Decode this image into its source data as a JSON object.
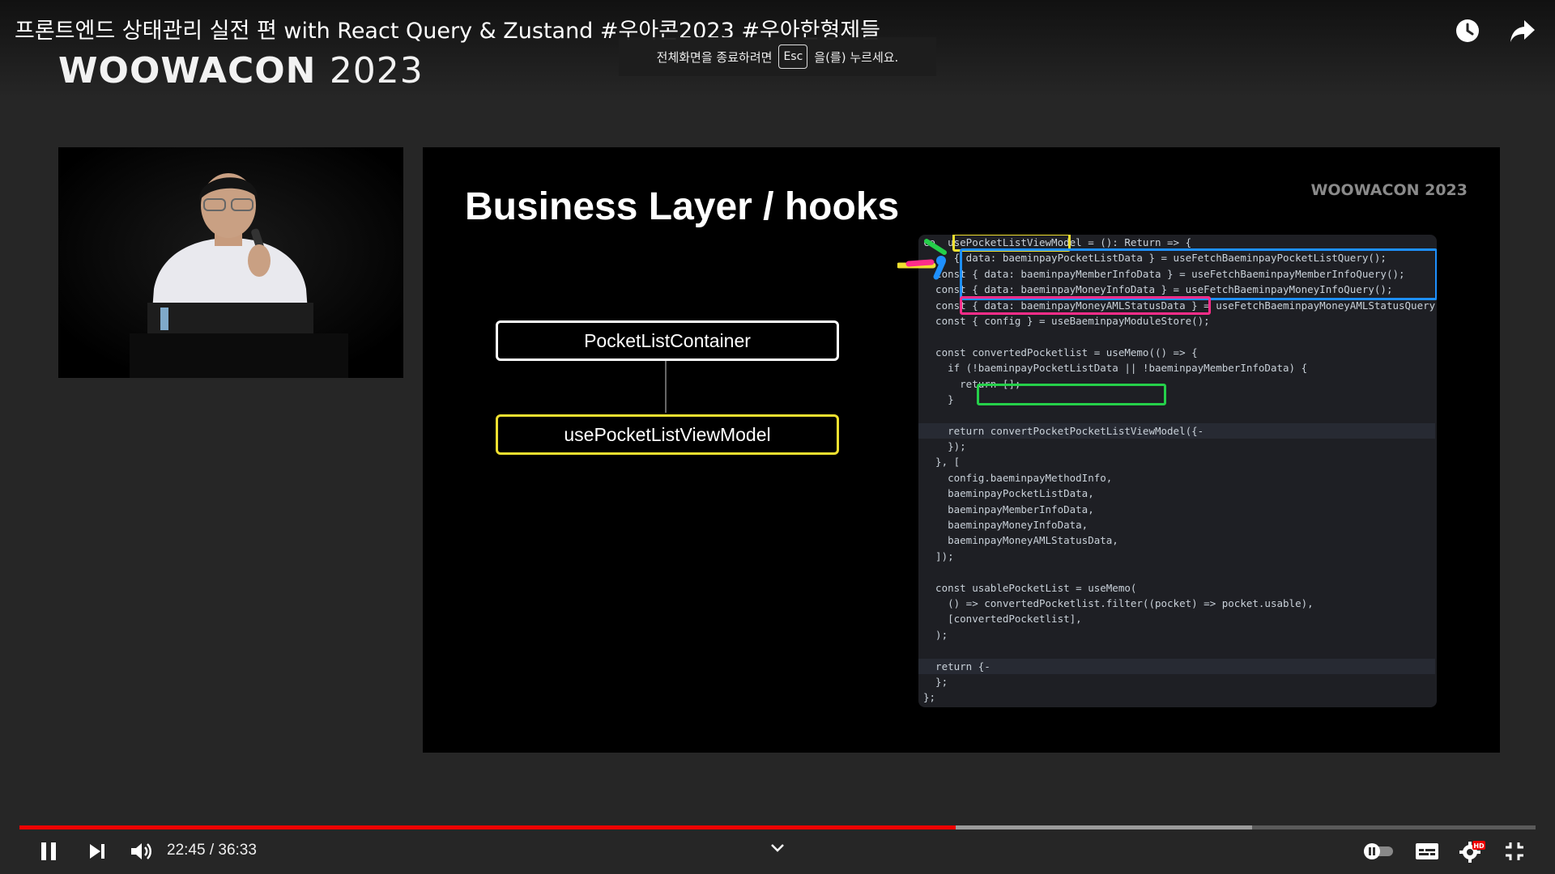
{
  "video": {
    "title": "프론트엔드 상태관리 실전 편 with React Query & Zustand #우아콘2023 #우아한형제들",
    "progress": 0.6174,
    "buffered": 0.8128,
    "time_display": "22:45 / 36:33"
  },
  "toast": {
    "before": "전체화면을 종료하려면",
    "key": "Esc",
    "after": "을(를) 누르세요."
  },
  "event_logo": {
    "name": "WOOWACON",
    "year": "2023"
  },
  "slide": {
    "title": "Business Layer / hooks",
    "logo": "WOOWACON 2023",
    "container_box": "PocketListContainer",
    "hook_box": "usePocketListViewModel",
    "code_lines": [
      "co  usePocketListViewModel = (): Return => {",
      "     { data: baeminpayPocketListData } = useFetchBaeminpayPocketListQuery();",
      "  const { data: baeminpayMemberInfoData } = useFetchBaeminpayMemberInfoQuery();",
      "  const { data: baeminpayMoneyInfoData } = useFetchBaeminpayMoneyInfoQuery();",
      "  const { data: baeminpayMoneyAMLStatusData } = useFetchBaeminpayMoneyAMLStatusQuery",
      "  const { config } = useBaeminpayModuleStore();",
      "",
      "  const convertedPocketlist = useMemo(() => {",
      "    if (!baeminpayPocketListData || !baeminpayMemberInfoData) {",
      "      return [];",
      "    }",
      "",
      "    return convertPocketPocketListViewModel({-",
      "    });",
      "  }, [",
      "    config.baeminpayMethodInfo,",
      "    baeminpayPocketListData,",
      "    baeminpayMemberInfoData,",
      "    baeminpayMoneyInfoData,",
      "    baeminpayMoneyAMLStatusData,",
      "  ]);",
      "",
      "  const usablePocketList = useMemo(",
      "    () => convertedPocketlist.filter((pocket) => pocket.usable),",
      "    [convertedPocketlist],",
      "  );",
      "",
      "  return {-",
      "  };",
      "};"
    ]
  },
  "icons": {
    "watch_later": "clock-icon",
    "share": "share-arrow-icon",
    "pause": "pause-icon",
    "next": "skip-next-icon",
    "volume": "volume-icon",
    "chevron": "chevron-down-icon",
    "autoplay": "autoplay-toggle-icon",
    "subtitles": "subtitles-icon",
    "settings": "settings-gear-icon",
    "fullscreen_exit": "fullscreen-exit-icon"
  },
  "badges": {
    "hd": "HD"
  },
  "colors": {
    "progress": "#ff0000",
    "highlight_yellow": "#f0e030",
    "highlight_blue": "#1e90ff",
    "highlight_pink": "#ff2d8a",
    "highlight_green": "#25d04a"
  }
}
